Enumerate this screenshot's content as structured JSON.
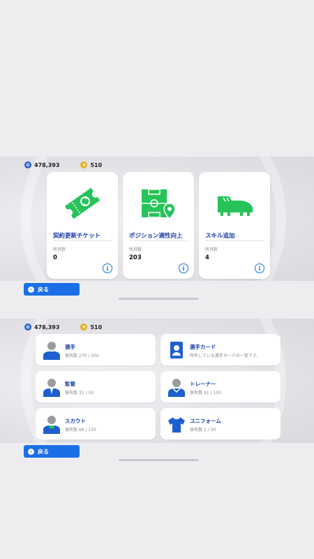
{
  "top_screen": {
    "currency": {
      "gp": "478,393",
      "coins": "510"
    },
    "cards": [
      {
        "title": "契約更新チケット",
        "sub_label": "所持数",
        "value": "0",
        "icon": "ticket-renew-icon"
      },
      {
        "title": "ポジション適性向上",
        "sub_label": "所持数",
        "value": "203",
        "icon": "pitch-position-icon"
      },
      {
        "title": "スキル追加",
        "sub_label": "所持数",
        "value": "4",
        "icon": "boot-icon"
      }
    ],
    "back_label": "戻る"
  },
  "bottom_screen": {
    "currency": {
      "gp": "478,393",
      "coins": "510"
    },
    "items": [
      {
        "title": "選手",
        "subtitle": "保有数 270 / 500",
        "icon": "player-silhouette-icon"
      },
      {
        "title": "選手カード",
        "subtitle": "所有している選手カードの一覧です。",
        "icon": "player-card-icon"
      },
      {
        "title": "監督",
        "subtitle": "保有数 31 / 50",
        "icon": "manager-silhouette-icon"
      },
      {
        "title": "トレーナー",
        "subtitle": "保有数 41 / 100",
        "icon": "trainer-silhouette-icon"
      },
      {
        "title": "スカウト",
        "subtitle": "保有数 68 / 150",
        "icon": "scout-silhouette-icon"
      },
      {
        "title": "ユニフォーム",
        "subtitle": "保有数 2 / 30",
        "icon": "uniform-icon"
      }
    ],
    "back_label": "戻る"
  },
  "colors": {
    "accent_blue": "#1a6fe6",
    "title_blue": "#1d3fa8",
    "icon_green": "#27c35a"
  }
}
